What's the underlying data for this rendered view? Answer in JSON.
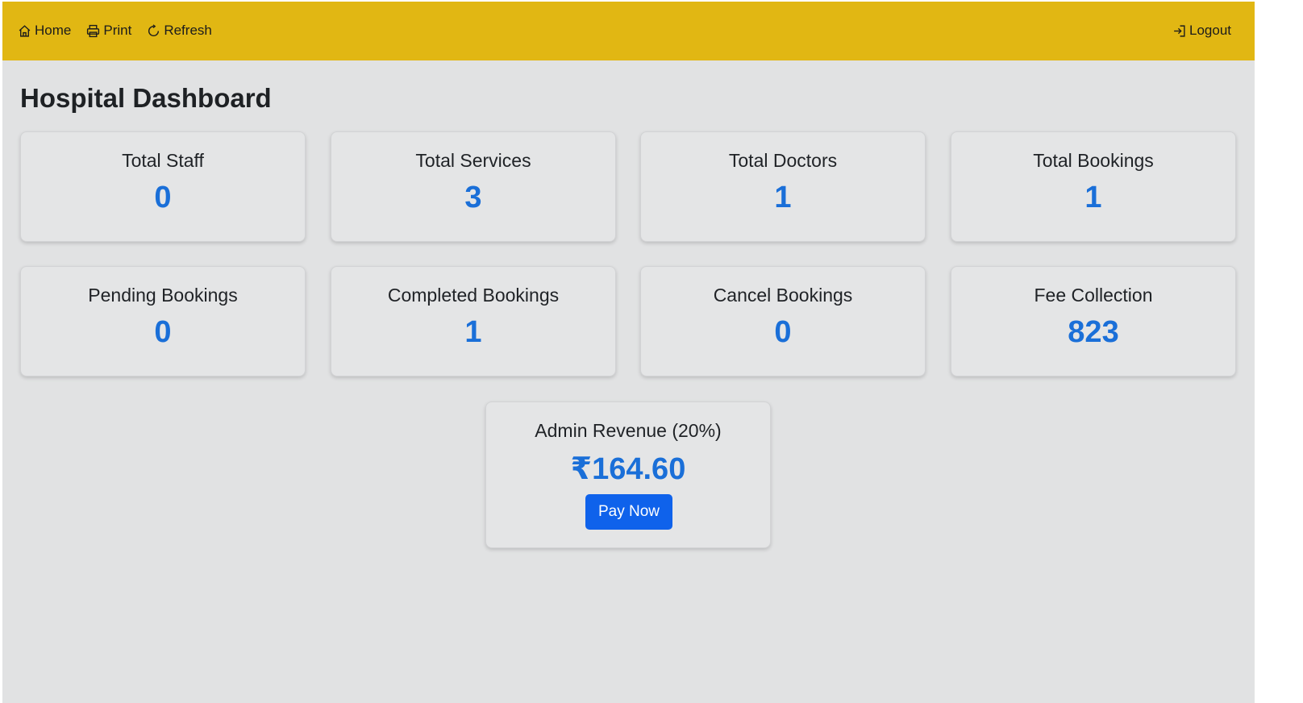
{
  "nav": {
    "home": {
      "label": "Home",
      "icon": "home-icon"
    },
    "print": {
      "label": "Print",
      "icon": "printer-icon"
    },
    "refresh": {
      "label": "Refresh",
      "icon": "refresh-icon"
    },
    "logout": {
      "label": "Logout",
      "icon": "logout-icon"
    }
  },
  "page_title": "Hospital Dashboard",
  "stats": [
    {
      "title": "Total Staff",
      "value": "0"
    },
    {
      "title": "Total Services",
      "value": "3"
    },
    {
      "title": "Total Doctors",
      "value": "1"
    },
    {
      "title": "Total Bookings",
      "value": "1"
    },
    {
      "title": "Pending Bookings",
      "value": "0"
    },
    {
      "title": "Completed Bookings",
      "value": "1"
    },
    {
      "title": "Cancel Bookings",
      "value": "0"
    },
    {
      "title": "Fee Collection",
      "value": "823"
    }
  ],
  "revenue": {
    "title": "Admin Revenue (20%)",
    "value": "₹164.60",
    "button_label": "Pay Now"
  },
  "colors": {
    "navbar": "#e1b713",
    "accent_value": "#1a6fd8",
    "button": "#0f62eb",
    "background": "#e1e2e3"
  }
}
